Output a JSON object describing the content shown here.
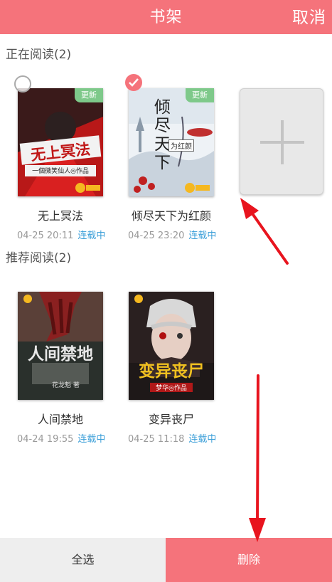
{
  "header": {
    "title": "书架",
    "cancel_label": "取消"
  },
  "sections": {
    "reading": "正在阅读(2)",
    "recommend": "推荐阅读(2)"
  },
  "reading_books": [
    {
      "title": "无上冥法",
      "date": "04-25 20:11",
      "status": "连载中",
      "badge": "更新",
      "selected": false,
      "cover_text": "无上冥法",
      "cover_sub": "一個微笑仙人◎作品"
    },
    {
      "title": "倾尽天下为红颜",
      "date": "04-25 23:20",
      "status": "连载中",
      "badge": "更新",
      "selected": true,
      "cover_text": "倾尽天下",
      "cover_sub": "为红颜"
    }
  ],
  "recommend_books": [
    {
      "title": "人间禁地",
      "date": "04-24 19:55",
      "status": "连载中",
      "cover_text": "人间禁地",
      "cover_sub": "花龙魁 著"
    },
    {
      "title": "变异丧尸",
      "date": "04-25 11:18",
      "status": "连载中",
      "cover_text": "变异丧尸",
      "cover_sub": "梦华◎作品"
    }
  ],
  "bottom": {
    "select_all": "全选",
    "delete": "删除"
  },
  "colors": {
    "accent": "#f5737b",
    "badge": "#7ec98a",
    "status": "#3a9ed8",
    "arrow": "#e8141e"
  }
}
